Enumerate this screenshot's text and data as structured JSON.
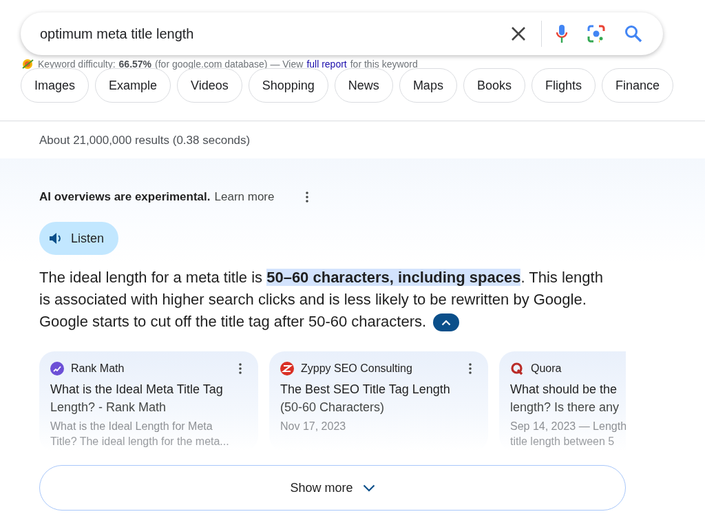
{
  "search": {
    "value": "optimum meta title length"
  },
  "keyword_difficulty": {
    "label": "Keyword difficulty:",
    "value": "66.57%",
    "note": "(for google.com database) — View",
    "link": "full report",
    "suffix": "for this keyword"
  },
  "chips": [
    {
      "label": "Images"
    },
    {
      "label": "Example"
    },
    {
      "label": "Videos"
    },
    {
      "label": "Shopping"
    },
    {
      "label": "News"
    },
    {
      "label": "Maps"
    },
    {
      "label": "Books"
    },
    {
      "label": "Flights"
    },
    {
      "label": "Finance"
    }
  ],
  "result_stats": "About 21,000,000 results (0.38 seconds)",
  "ai_overview": {
    "notice": "AI overviews are experimental.",
    "learn_more": "Learn more",
    "listen": "Listen",
    "answer": "The ideal length for a meta title is **50–60 characters, including spaces**. This length is associated with higher search clicks and is less likely to be rewritten by Google. Google starts to cut off the title tag after 50-60 characters.",
    "expanded": true,
    "sources": [
      {
        "site": "Rank Math",
        "kind": "rankmath",
        "title_lines": [
          "What is the Ideal Meta Title Tag",
          "Length? - Rank Math"
        ],
        "snippet_lines": [
          "What is the Ideal Length for Meta",
          "Title? The ideal length for the meta..."
        ],
        "menu": true
      },
      {
        "site": "Zyppy SEO Consulting",
        "kind": "zyppy",
        "title_lines": [
          "The Best SEO Title Tag Length",
          "(50-60 Characters)"
        ],
        "snippet_lines": [
          "Nov 17, 2023"
        ],
        "menu": true
      },
      {
        "site": "Quora",
        "kind": "quora",
        "title_lines": [
          "What should be the",
          "length? Is there any"
        ],
        "snippet_lines": [
          "Sep 14, 2023 — Length",
          "title length between 5"
        ],
        "menu": false
      }
    ],
    "show_more": "Show more"
  }
}
